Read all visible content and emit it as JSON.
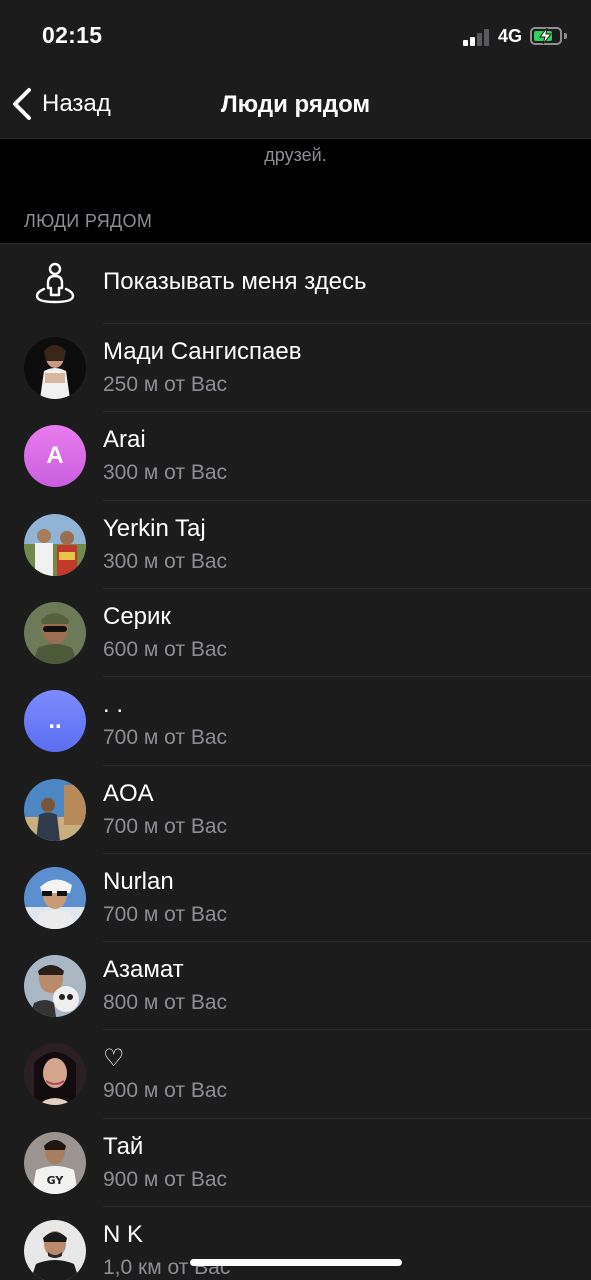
{
  "status_bar": {
    "time": "02:15",
    "network": "4G",
    "signal_bars_active": 2,
    "signal_bars_total": 4,
    "battery_level": 0.75,
    "battery_charging": true
  },
  "nav": {
    "back_label": "Назад",
    "title": "Люди рядом"
  },
  "info": {
    "text": "друзей."
  },
  "section": {
    "header": "ЛЮДИ РЯДОМ"
  },
  "show_me": {
    "label": "Показывать меня здесь",
    "icon": "location-person-icon"
  },
  "people": [
    {
      "name": "Мади Сангиспаев",
      "distance": "250 м от Вас",
      "avatar": "photo"
    },
    {
      "name": "Arai",
      "distance": "300 м от Вас",
      "avatar": "letter",
      "letter": "A"
    },
    {
      "name": "Yerkin Taj",
      "distance": "300 м от Вас",
      "avatar": "photo"
    },
    {
      "name": "Серик",
      "distance": "600 м от Вас",
      "avatar": "photo"
    },
    {
      "name": ". .",
      "distance": "700 м от Вас",
      "avatar": "letter",
      "letter": ".."
    },
    {
      "name": "AOA",
      "distance": "700 м от Вас",
      "avatar": "photo"
    },
    {
      "name": "Nurlan",
      "distance": "700 м от Вас",
      "avatar": "photo"
    },
    {
      "name": "Азамат",
      "distance": "800 м от Вас",
      "avatar": "photo"
    },
    {
      "name": "♡",
      "distance": "900 м от Вас",
      "avatar": "photo"
    },
    {
      "name": "Тай",
      "distance": "900 м от Вас",
      "avatar": "photo"
    },
    {
      "name": "N K",
      "distance": "1,0 км от Вас",
      "avatar": "photo"
    }
  ],
  "colors": {
    "background": "#1c1c1d",
    "secondary_text": "#8d8e93",
    "separator": "#2c2c2e",
    "avatar_pink": "#d36ee6",
    "avatar_blue": "#6b7bf5"
  }
}
